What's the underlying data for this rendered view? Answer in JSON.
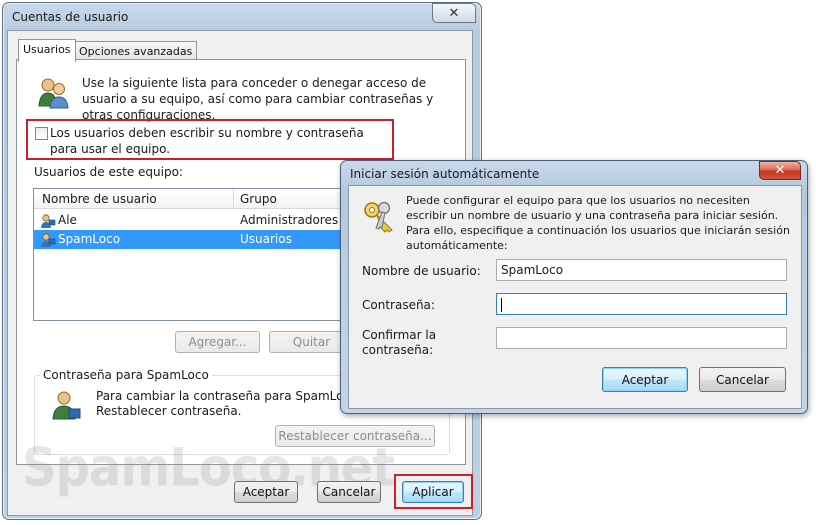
{
  "main_window": {
    "title": "Cuentas de usuario",
    "tabs": [
      {
        "label": "Usuarios",
        "active": true
      },
      {
        "label": "Opciones avanzadas",
        "active": false
      }
    ],
    "intro_text": "Use la siguiente lista para conceder o denegar acceso de usuario a su equipo, así como para cambiar contraseñas y otras configuraciones.",
    "require_login_checkbox": {
      "label": "Los usuarios deben escribir su nombre y contraseña para usar el equipo.",
      "checked": false
    },
    "users_section_label": "Usuarios de este equipo:",
    "users_table": {
      "columns": [
        "Nombre de usuario",
        "Grupo"
      ],
      "rows": [
        {
          "name": "Ale",
          "group": "Administradores",
          "selected": false
        },
        {
          "name": "SpamLoco",
          "group": "Usuarios",
          "selected": true
        }
      ]
    },
    "buttons": {
      "add": "Agregar...",
      "remove": "Quitar",
      "reset_password": "Restablecer contraseña...",
      "ok": "Aceptar",
      "cancel": "Cancelar",
      "apply": "Aplicar"
    },
    "password_group": {
      "title": "Contraseña para SpamLoco",
      "text_line1": "Para cambiar la contraseña para SpamLoco, ha",
      "text_line2": "Restablecer contraseña."
    },
    "watermark": "SpamLoco.net"
  },
  "autologon_dialog": {
    "title": "Iniciar sesión automáticamente",
    "description": "Puede configurar el equipo para que los usuarios no necesiten escribir un nombre de usuario y una contraseña para iniciar sesión. Para ello, especifique a continuación los usuarios que iniciarán sesión automáticamente:",
    "fields": {
      "username_label": "Nombre de usuario:",
      "username_value": "SpamLoco",
      "password_label": "Contraseña:",
      "password_value": "",
      "confirm_label_line1": "Confirmar la",
      "confirm_label_line2": "contraseña:",
      "confirm_value": ""
    },
    "buttons": {
      "ok": "Aceptar",
      "cancel": "Cancelar"
    }
  },
  "icons": {
    "main_close": "close-icon",
    "dialog_close": "close-icon",
    "users": "users-icon",
    "keys": "keys-icon",
    "user_row": "user-icon"
  },
  "colors": {
    "selection": "#3399ff",
    "highlight_box": "#cc1f2a",
    "title_bar": "#b6cadf"
  }
}
